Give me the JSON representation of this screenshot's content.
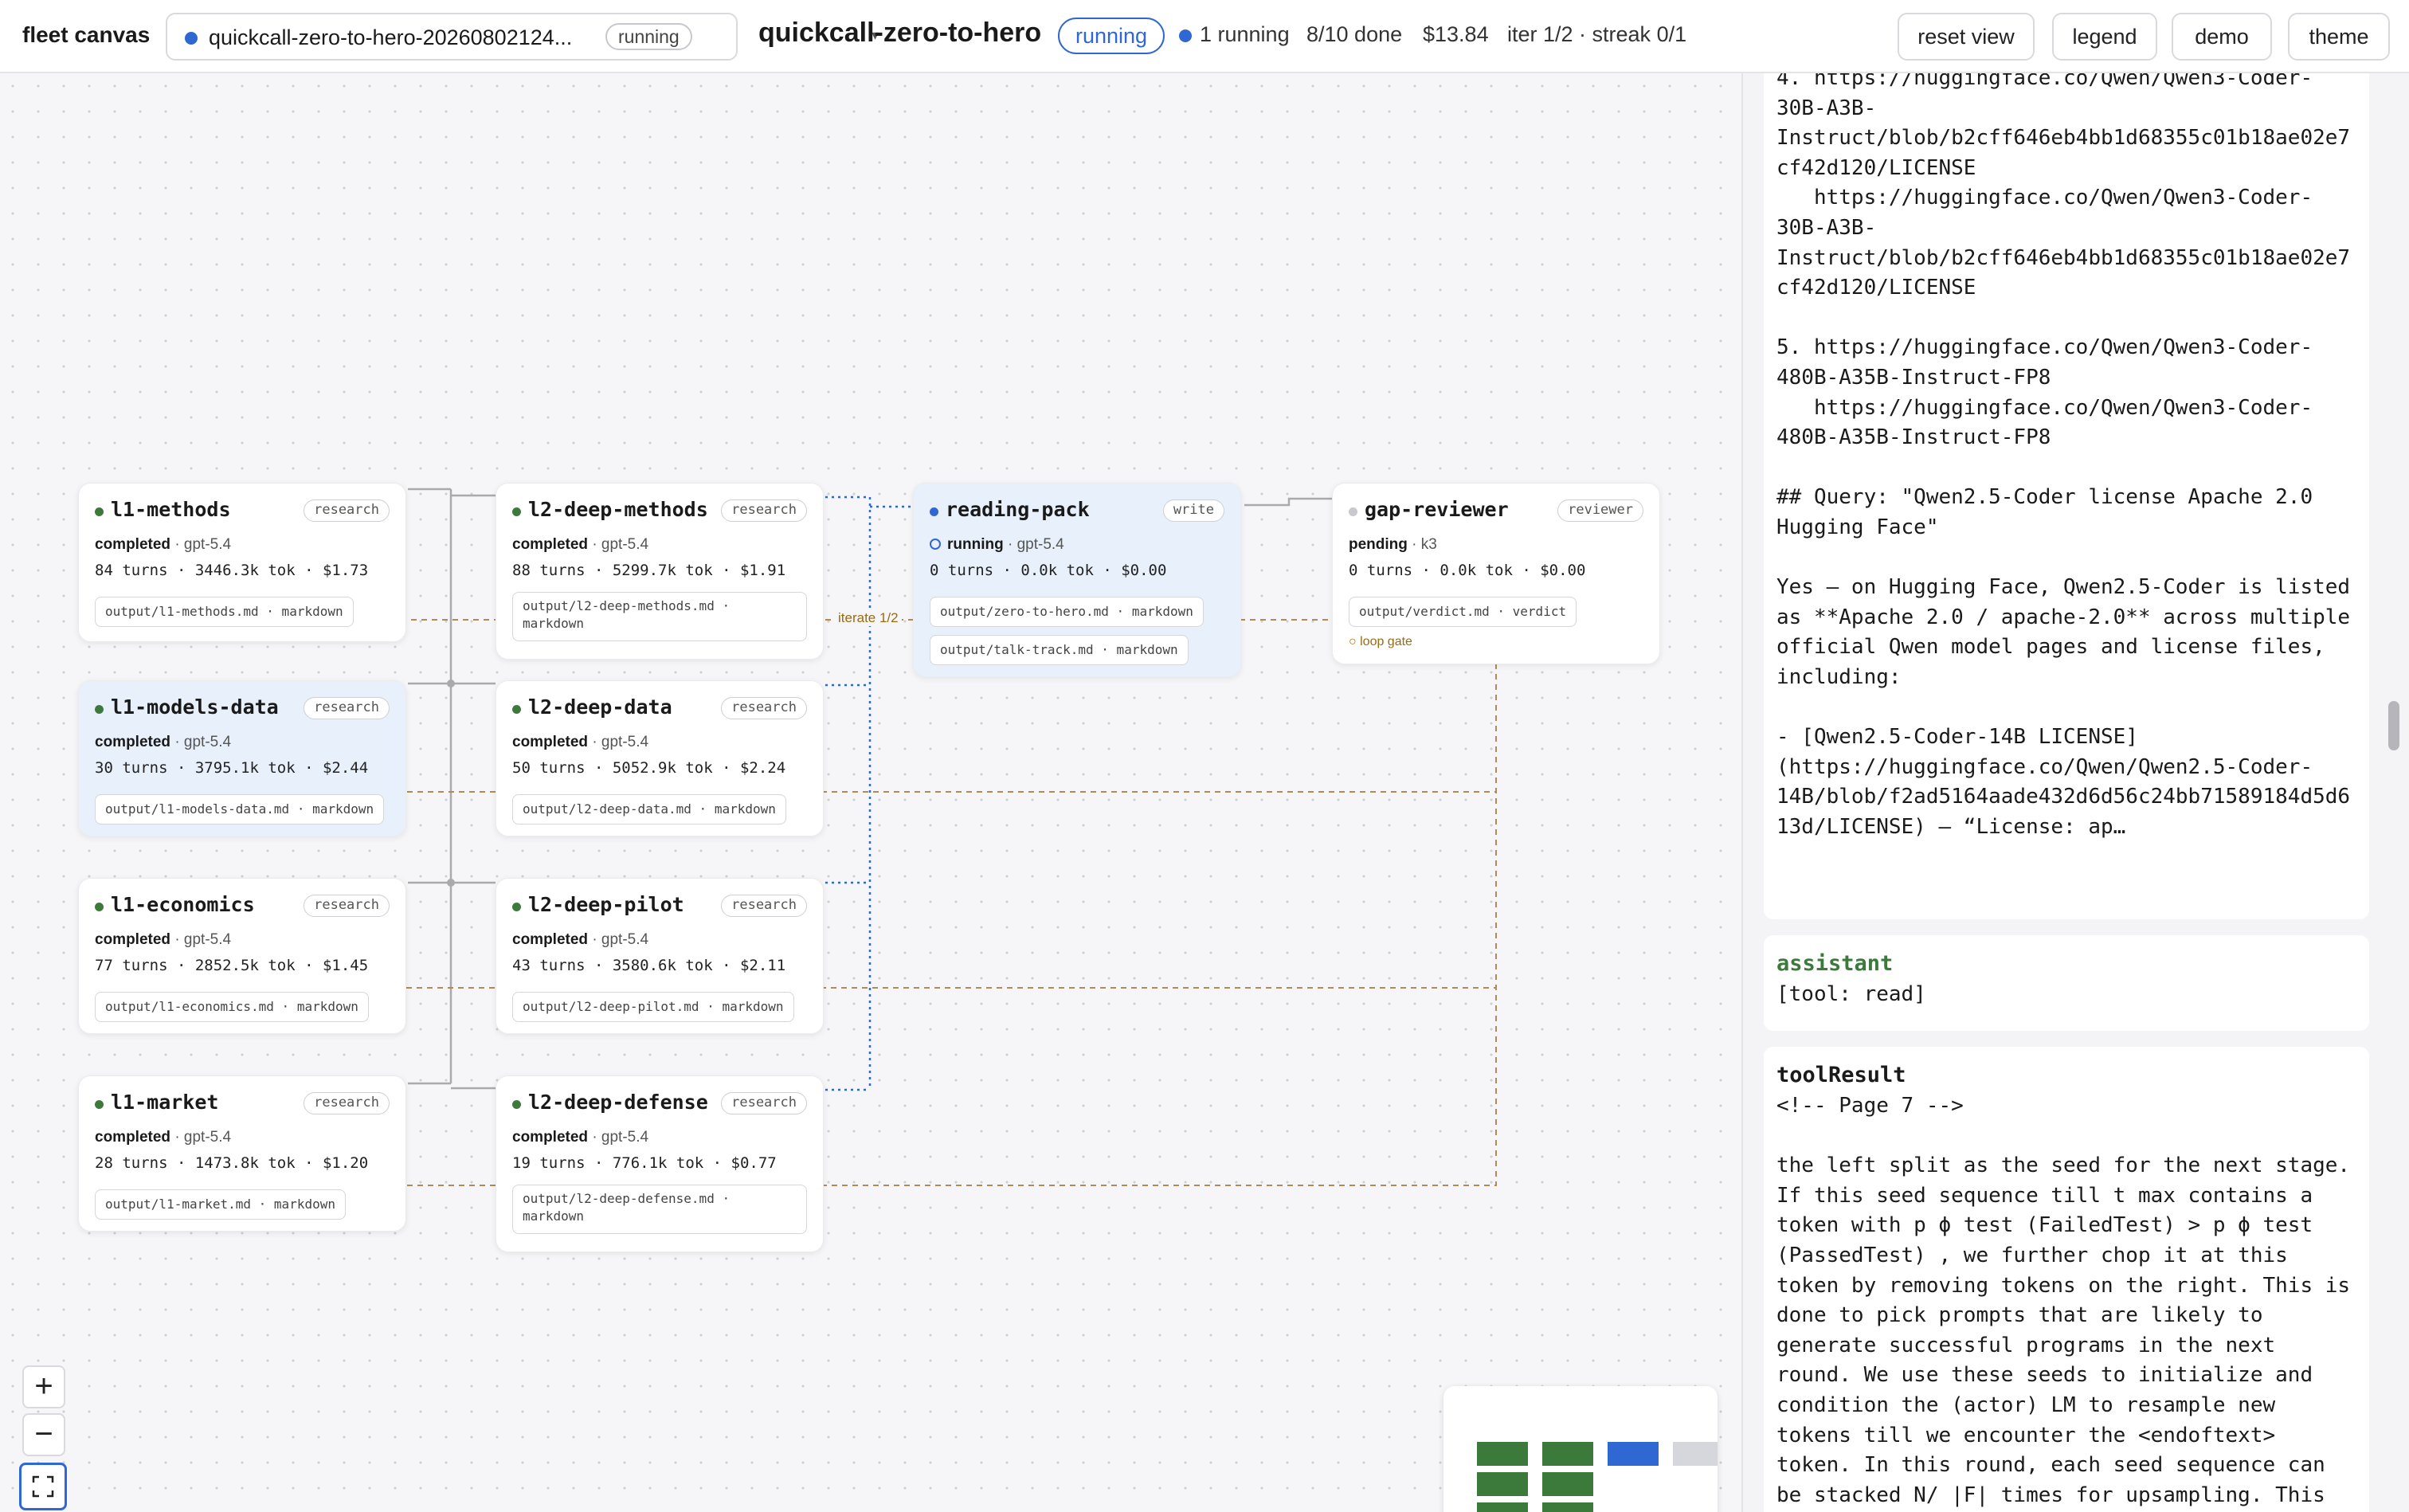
{
  "colors": {
    "completed": "#3c7a3c",
    "running": "#2f67d3",
    "pending": "#c8c8cd",
    "edge_solid": "#a9a9ae",
    "edge_dotted": "#2f67d3",
    "edge_loop": "#b08a5a",
    "assistant_role": "#3c7a3c"
  },
  "topbar": {
    "brand": "fleet canvas",
    "run_selector": {
      "dot_icon": "status-dot",
      "name": "quickcall-zero-to-hero-20260802124...",
      "status_pill": "running",
      "caret_icon": "chevron-down"
    },
    "title": "quickcall-zero-to-hero",
    "status": "running",
    "stats": {
      "running": "1 running",
      "done": "8/10 done",
      "cost": "$13.84",
      "iter": "iter 1/2 · streak 0/1"
    },
    "buttons": {
      "reset_view": "reset view",
      "legend": "legend",
      "demo": "demo",
      "theme": "theme"
    }
  },
  "canvas": {
    "edge_label": "iterate 1/2",
    "nodes": [
      {
        "name": "l1-methods",
        "tag": "research",
        "status": "completed",
        "model": "gpt-5.4",
        "stats": "84 turns · 3446.3k tok · $1.73",
        "outputs": [
          "output/l1-methods.md · markdown"
        ],
        "selected": false
      },
      {
        "name": "l1-models-data",
        "tag": "research",
        "status": "completed",
        "model": "gpt-5.4",
        "stats": "30 turns · 3795.1k tok · $2.44",
        "outputs": [
          "output/l1-models-data.md · markdown"
        ],
        "selected": true
      },
      {
        "name": "l1-economics",
        "tag": "research",
        "status": "completed",
        "model": "gpt-5.4",
        "stats": "77 turns · 2852.5k tok · $1.45",
        "outputs": [
          "output/l1-economics.md · markdown"
        ],
        "selected": false
      },
      {
        "name": "l1-market",
        "tag": "research",
        "status": "completed",
        "model": "gpt-5.4",
        "stats": "28 turns · 1473.8k tok · $1.20",
        "outputs": [
          "output/l1-market.md · markdown"
        ],
        "selected": false
      },
      {
        "name": "l2-deep-methods",
        "tag": "research",
        "status": "completed",
        "model": "gpt-5.4",
        "stats": "88 turns · 5299.7k tok · $1.91",
        "outputs": [
          "output/l2-deep-methods.md · markdown"
        ],
        "selected": false
      },
      {
        "name": "l2-deep-data",
        "tag": "research",
        "status": "completed",
        "model": "gpt-5.4",
        "stats": "50 turns · 5052.9k tok · $2.24",
        "outputs": [
          "output/l2-deep-data.md · markdown"
        ],
        "selected": false
      },
      {
        "name": "l2-deep-pilot",
        "tag": "research",
        "status": "completed",
        "model": "gpt-5.4",
        "stats": "43 turns · 3580.6k tok · $2.11",
        "outputs": [
          "output/l2-deep-pilot.md · markdown"
        ],
        "selected": false
      },
      {
        "name": "l2-deep-defense",
        "tag": "research",
        "status": "completed",
        "model": "gpt-5.4",
        "stats": "19 turns · 776.1k tok · $0.77",
        "outputs": [
          "output/l2-deep-defense.md · markdown"
        ],
        "selected": false
      },
      {
        "name": "reading-pack",
        "tag": "write",
        "status": "running",
        "model": "gpt-5.4",
        "stats": "0 turns · 0.0k tok · $0.00",
        "outputs": [
          "output/zero-to-hero.md · markdown",
          "output/talk-track.md · markdown"
        ],
        "selected": true
      },
      {
        "name": "gap-reviewer",
        "tag": "reviewer",
        "status": "pending",
        "model": "k3",
        "stats": "0 turns · 0.0k tok · $0.00",
        "outputs": [
          "output/verdict.md · verdict"
        ],
        "gate": "○ loop gate",
        "selected": false
      }
    ],
    "zoom": {
      "in_icon": "plus-icon",
      "in": "+",
      "out_icon": "minus-icon",
      "out": "−",
      "fit_icon": "fit-view-icon"
    }
  },
  "panel": {
    "messages": [
      {
        "role": "",
        "text": "4. https://huggingface.co/Qwen/Qwen3-Coder-\n30B-A3B-\nInstruct/blob/b2cff646eb4bb1d68355c01b18ae02e7\ncf42d120/LICENSE\n   https://huggingface.co/Qwen/Qwen3-Coder-\n30B-A3B-\nInstruct/blob/b2cff646eb4bb1d68355c01b18ae02e7\ncf42d120/LICENSE\n\n5. https://huggingface.co/Qwen/Qwen3-Coder-\n480B-A35B-Instruct-FP8\n   https://huggingface.co/Qwen/Qwen3-Coder-\n480B-A35B-Instruct-FP8\n\n## Query: \"Qwen2.5-Coder license Apache 2.0\nHugging Face\"\n\nYes — on Hugging Face, Qwen2.5-Coder is listed\nas **Apache 2.0 / apache-2.0** across multiple\nofficial Qwen model pages and license files,\nincluding:\n\n- [Qwen2.5-Coder-14B LICENSE]\n(https://huggingface.co/Qwen/Qwen2.5-Coder-\n14B/blob/f2ad5164aade432d6d56c24bb71589184d5d6\n13d/LICENSE) — “License: ap…"
      },
      {
        "role": "assistant",
        "text": "[tool: read]"
      },
      {
        "role": "toolResult",
        "text": "<!-- Page 7 -->\n\nthe left split as the seed for the next stage.\nIf this seed sequence till t max contains a\ntoken with p ϕ test (FailedTest) > p ϕ test\n(PassedTest) , we further chop it at this\ntoken by removing tokens on the right. This is\ndone to pick prompts that are likely to\ngenerate successful programs in the next\nround. We use these seeds to initialize and\ncondition the (actor) LM to resample new\ntokens till we encounter the <endoftext>\ntoken. In this round, each seed sequence can\nbe stacked N/ |F| times for upsampling. This\nresults in the same number of output programs\nN . We call this generation procedure “Critic"
      }
    ]
  }
}
